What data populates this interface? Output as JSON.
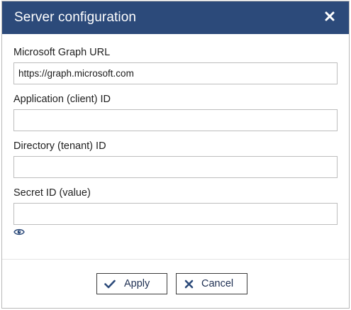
{
  "dialog": {
    "title": "Server configuration",
    "close_icon": "close-icon"
  },
  "fields": {
    "graph_url": {
      "label": "Microsoft Graph URL",
      "value": "https://graph.microsoft.com",
      "placeholder": ""
    },
    "client_id": {
      "label": "Application (client) ID",
      "value": "",
      "placeholder": ""
    },
    "tenant_id": {
      "label": "Directory (tenant) ID",
      "value": "",
      "placeholder": ""
    },
    "secret": {
      "label": "Secret ID (value)",
      "value": "",
      "placeholder": "",
      "reveal_icon": "eye-icon"
    }
  },
  "buttons": {
    "apply": {
      "label": "Apply",
      "icon": "check-icon"
    },
    "cancel": {
      "label": "Cancel",
      "icon": "x-icon"
    }
  },
  "colors": {
    "titlebar": "#2c4a7a",
    "button_text": "#1e2f52",
    "icon_blue": "#2c4a7a"
  }
}
